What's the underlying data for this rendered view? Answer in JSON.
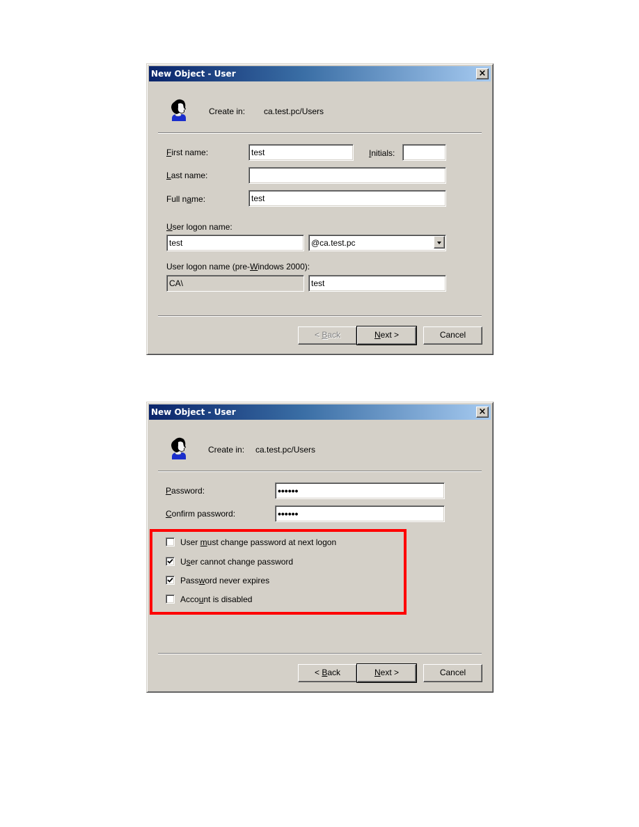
{
  "dialog1": {
    "title": "New Object - User",
    "close_label": "×",
    "create_in_label": "Create in:",
    "create_in_value": "ca.test.pc/Users",
    "first_name": {
      "label_pre": "",
      "label_key": "F",
      "label_post": "irst name:",
      "value": "test"
    },
    "initials": {
      "label_key": "I",
      "label_post": "nitials:",
      "value": ""
    },
    "last_name": {
      "label_key": "L",
      "label_post": "ast name:",
      "value": ""
    },
    "full_name": {
      "label_pre": "Full n",
      "label_key": "a",
      "label_post": "me:",
      "value": "test"
    },
    "logon_name": {
      "label_key": "U",
      "label_post": "ser logon name:",
      "value": "test",
      "domain_value": "@ca.test.pc"
    },
    "pre2000": {
      "label_pre": "User logon name (pre-",
      "label_key": "W",
      "label_post": "indows 2000):",
      "domain_value": "CA\\",
      "value": "test"
    },
    "buttons": {
      "back": {
        "pre": "< ",
        "key": "B",
        "post": "ack",
        "enabled": false
      },
      "next": {
        "key": "N",
        "post": "ext >"
      },
      "cancel": "Cancel"
    }
  },
  "dialog2": {
    "title": "New Object - User",
    "close_label": "×",
    "create_in_label": "Create in:",
    "create_in_value": "ca.test.pc/Users",
    "password": {
      "label_key": "P",
      "label_post": "assword:",
      "value": "••••••"
    },
    "confirm_password": {
      "label_key": "C",
      "label_post": "onfirm password:",
      "value": "••••••"
    },
    "options": [
      {
        "pre": "User ",
        "key": "m",
        "post": "ust change password at next logon",
        "checked": false
      },
      {
        "pre": "U",
        "key": "s",
        "post": "er cannot change password",
        "checked": true
      },
      {
        "pre": "Pass",
        "key": "w",
        "post": "ord never expires",
        "checked": true
      },
      {
        "pre": "Acco",
        "key": "u",
        "post": "nt is disabled",
        "checked": false
      }
    ],
    "highlight_color": "#ff0000",
    "buttons": {
      "back": {
        "pre": "< ",
        "key": "B",
        "post": "ack",
        "enabled": true
      },
      "next": {
        "key": "N",
        "post": "ext >"
      },
      "cancel": "Cancel"
    }
  }
}
